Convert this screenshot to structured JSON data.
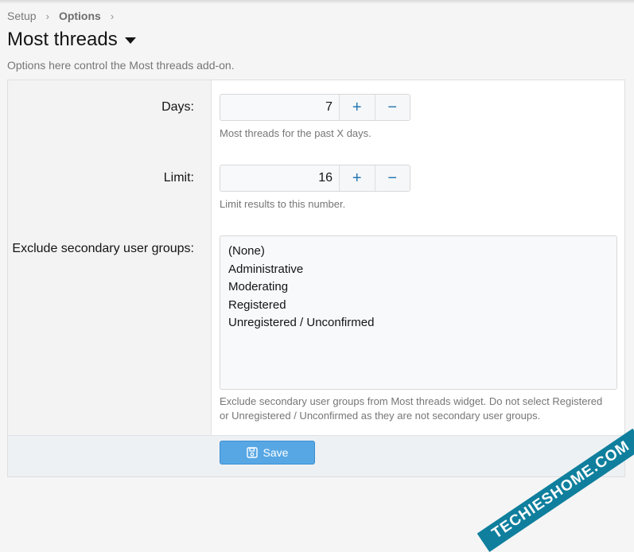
{
  "breadcrumb": {
    "items": [
      "Setup",
      "Options"
    ],
    "separator": "›"
  },
  "page": {
    "title": "Most threads",
    "description": "Options here control the Most threads add-on."
  },
  "fields": {
    "days": {
      "label": "Days:",
      "value": "7",
      "hint": "Most threads for the past X days.",
      "increment": "+",
      "decrement": "−"
    },
    "limit": {
      "label": "Limit:",
      "value": "16",
      "hint": "Limit results to this number.",
      "increment": "+",
      "decrement": "−"
    },
    "exclude_groups": {
      "label": "Exclude secondary user groups:",
      "options": [
        "(None)",
        "Administrative",
        "Moderating",
        "Registered",
        "Unregistered / Unconfirmed"
      ],
      "hint_line1": "Exclude secondary user groups from Most threads widget. Do not select Registered",
      "hint_line2": "or Unregistered / Unconfirmed as they are not secondary user groups."
    }
  },
  "footer": {
    "save_label": "Save"
  },
  "watermark": {
    "text": "TECHIESHOME.COM"
  },
  "colors": {
    "accent": "#2577b1",
    "save_button": "#57a7e4",
    "watermark": "#0f7f9d"
  },
  "icons": {
    "caret": "caret-down-icon",
    "save": "save-icon",
    "plus": "plus-icon",
    "minus": "minus-icon"
  }
}
